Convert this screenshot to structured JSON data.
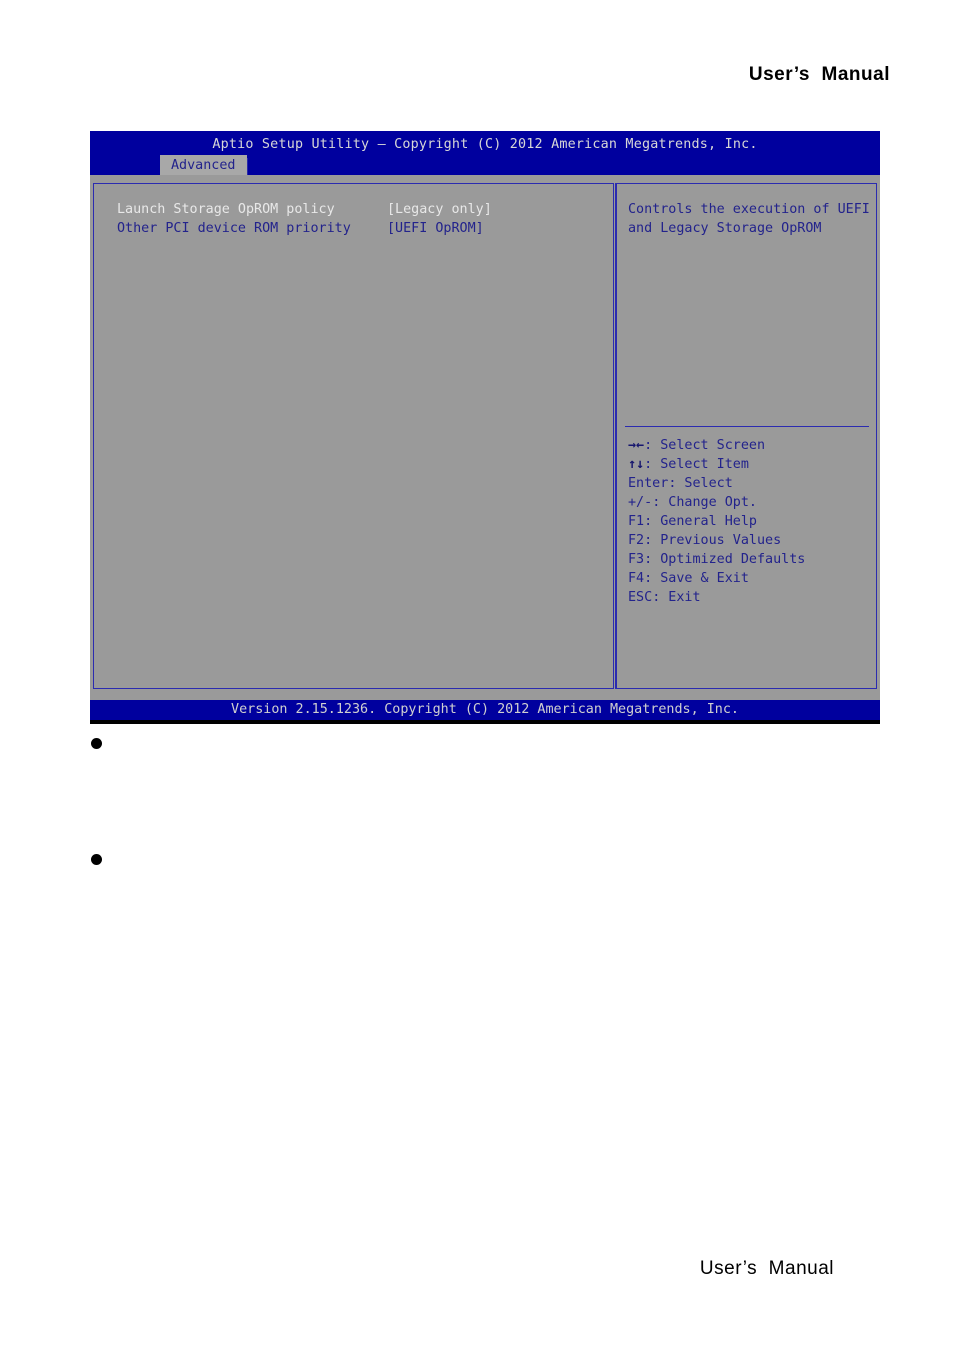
{
  "page": {
    "header_title": "User’s  Manual",
    "footer_title": "User’s  Manual",
    "bullets": [
      "",
      ""
    ]
  },
  "bios": {
    "title": "Aptio Setup Utility – Copyright (C) 2012 American Megatrends, Inc.",
    "active_tab": "Advanced",
    "tabs": [
      "Advanced"
    ],
    "settings": [
      {
        "label": "Launch Storage OpROM policy",
        "value": "[Legacy only]",
        "selected": true
      },
      {
        "label": "Other PCI device ROM priority",
        "value": "[UEFI OpROM]",
        "selected": false
      }
    ],
    "help": {
      "lines": [
        "Controls the execution of UEFI",
        "and Legacy Storage OpROM"
      ]
    },
    "nav_keys": [
      {
        "key": "→←",
        "label": ": Select Screen"
      },
      {
        "key": "↑↓",
        "label": ": Select Item"
      },
      {
        "key": "Enter",
        "label": ": Select"
      },
      {
        "key": "+/-",
        "label": ": Change Opt."
      },
      {
        "key": "F1",
        "label": ": General Help"
      },
      {
        "key": "F2",
        "label": ": Previous Values"
      },
      {
        "key": "F3",
        "label": ": Optimized Defaults"
      },
      {
        "key": "F4",
        "label": ": Save & Exit"
      },
      {
        "key": "ESC",
        "label": ": Exit"
      }
    ],
    "version_bar": "Version 2.15.1236. Copyright (C) 2012 American Megatrends, Inc.",
    "colors": {
      "banner_blue": "#00009e",
      "body_gray": "#9a9a9a",
      "text_blue": "#23238c",
      "text_white": "#e8e8e8",
      "border_blue": "#2b2bb0"
    }
  }
}
